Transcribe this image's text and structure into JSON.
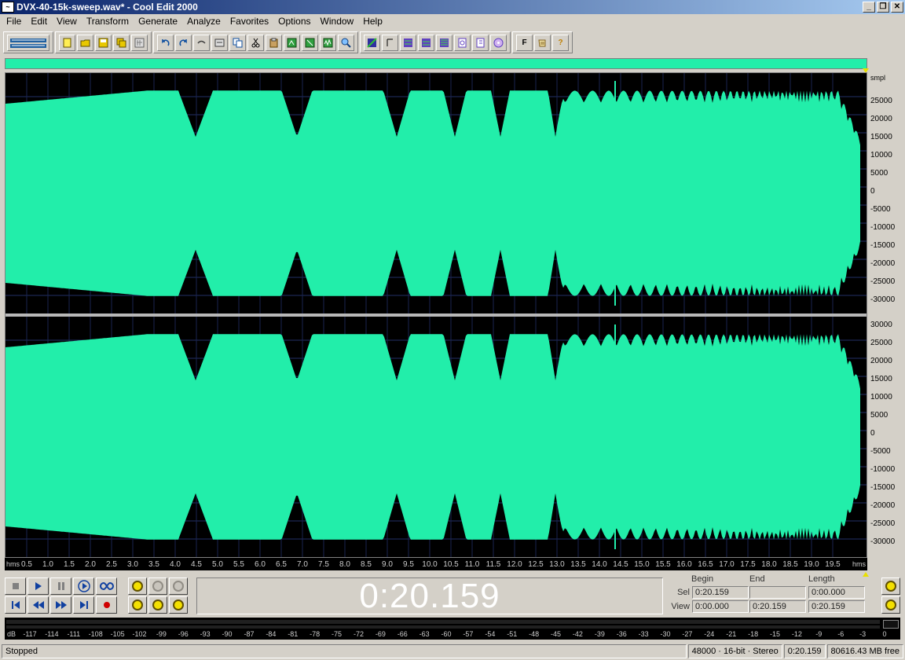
{
  "window": {
    "title": "DVX-40-15k-sweep.wav* - Cool Edit 2000",
    "minimize": "_",
    "restore": "❐",
    "close": "✕"
  },
  "menu": [
    "File",
    "Edit",
    "View",
    "Transform",
    "Generate",
    "Analyze",
    "Favorites",
    "Options",
    "Window",
    "Help"
  ],
  "toolbar": {
    "f_label": "F",
    "help_label": "?"
  },
  "waveform": {
    "color": "#22eeaa",
    "background": "#000000",
    "scale_unit": "smpl",
    "top_scale": [
      "25000",
      "20000",
      "15000",
      "10000",
      "5000",
      "0",
      "-5000",
      "-10000",
      "-15000",
      "-20000",
      "-25000",
      "-30000"
    ],
    "bottom_scale": [
      "30000",
      "25000",
      "20000",
      "15000",
      "10000",
      "5000",
      "0",
      "-5000",
      "-10000",
      "-15000",
      "-20000",
      "-25000",
      "-30000"
    ]
  },
  "ruler": {
    "unit_left": "hms",
    "unit_right": "hms",
    "labels": [
      "0.5",
      "1.0",
      "1.5",
      "2.0",
      "2.5",
      "3.0",
      "3.5",
      "4.0",
      "4.5",
      "5.0",
      "5.5",
      "6.0",
      "6.5",
      "7.0",
      "7.5",
      "8.0",
      "8.5",
      "9.0",
      "9.5",
      "10.0",
      "10.5",
      "11.0",
      "11.5",
      "12.0",
      "12.5",
      "13.0",
      "13.5",
      "14.0",
      "14.5",
      "15.0",
      "15.5",
      "16.0",
      "16.5",
      "17.0",
      "17.5",
      "18.0",
      "18.5",
      "19.0",
      "19.5"
    ]
  },
  "time_display": "0:20.159",
  "selection": {
    "begin_label": "Begin",
    "end_label": "End",
    "length_label": "Length",
    "sel_label": "Sel",
    "view_label": "View",
    "sel_begin": "0:20.159",
    "sel_end": "",
    "sel_length": "0:00.000",
    "view_begin": "0:00.000",
    "view_end": "0:20.159",
    "view_length": "0:20.159"
  },
  "meter": {
    "unit": "dB",
    "labels": [
      "-117",
      "-114",
      "-111",
      "-108",
      "-105",
      "-102",
      "-99",
      "-96",
      "-93",
      "-90",
      "-87",
      "-84",
      "-81",
      "-78",
      "-75",
      "-72",
      "-69",
      "-66",
      "-63",
      "-60",
      "-57",
      "-54",
      "-51",
      "-48",
      "-45",
      "-42",
      "-39",
      "-36",
      "-33",
      "-30",
      "-27",
      "-24",
      "-21",
      "-18",
      "-15",
      "-12",
      "-9",
      "-6",
      "-3",
      "0"
    ]
  },
  "status": {
    "state": "Stopped",
    "format": "48000 · 16-bit · Stereo",
    "position": "0:20.159",
    "free_space": "80616.43 MB free"
  }
}
